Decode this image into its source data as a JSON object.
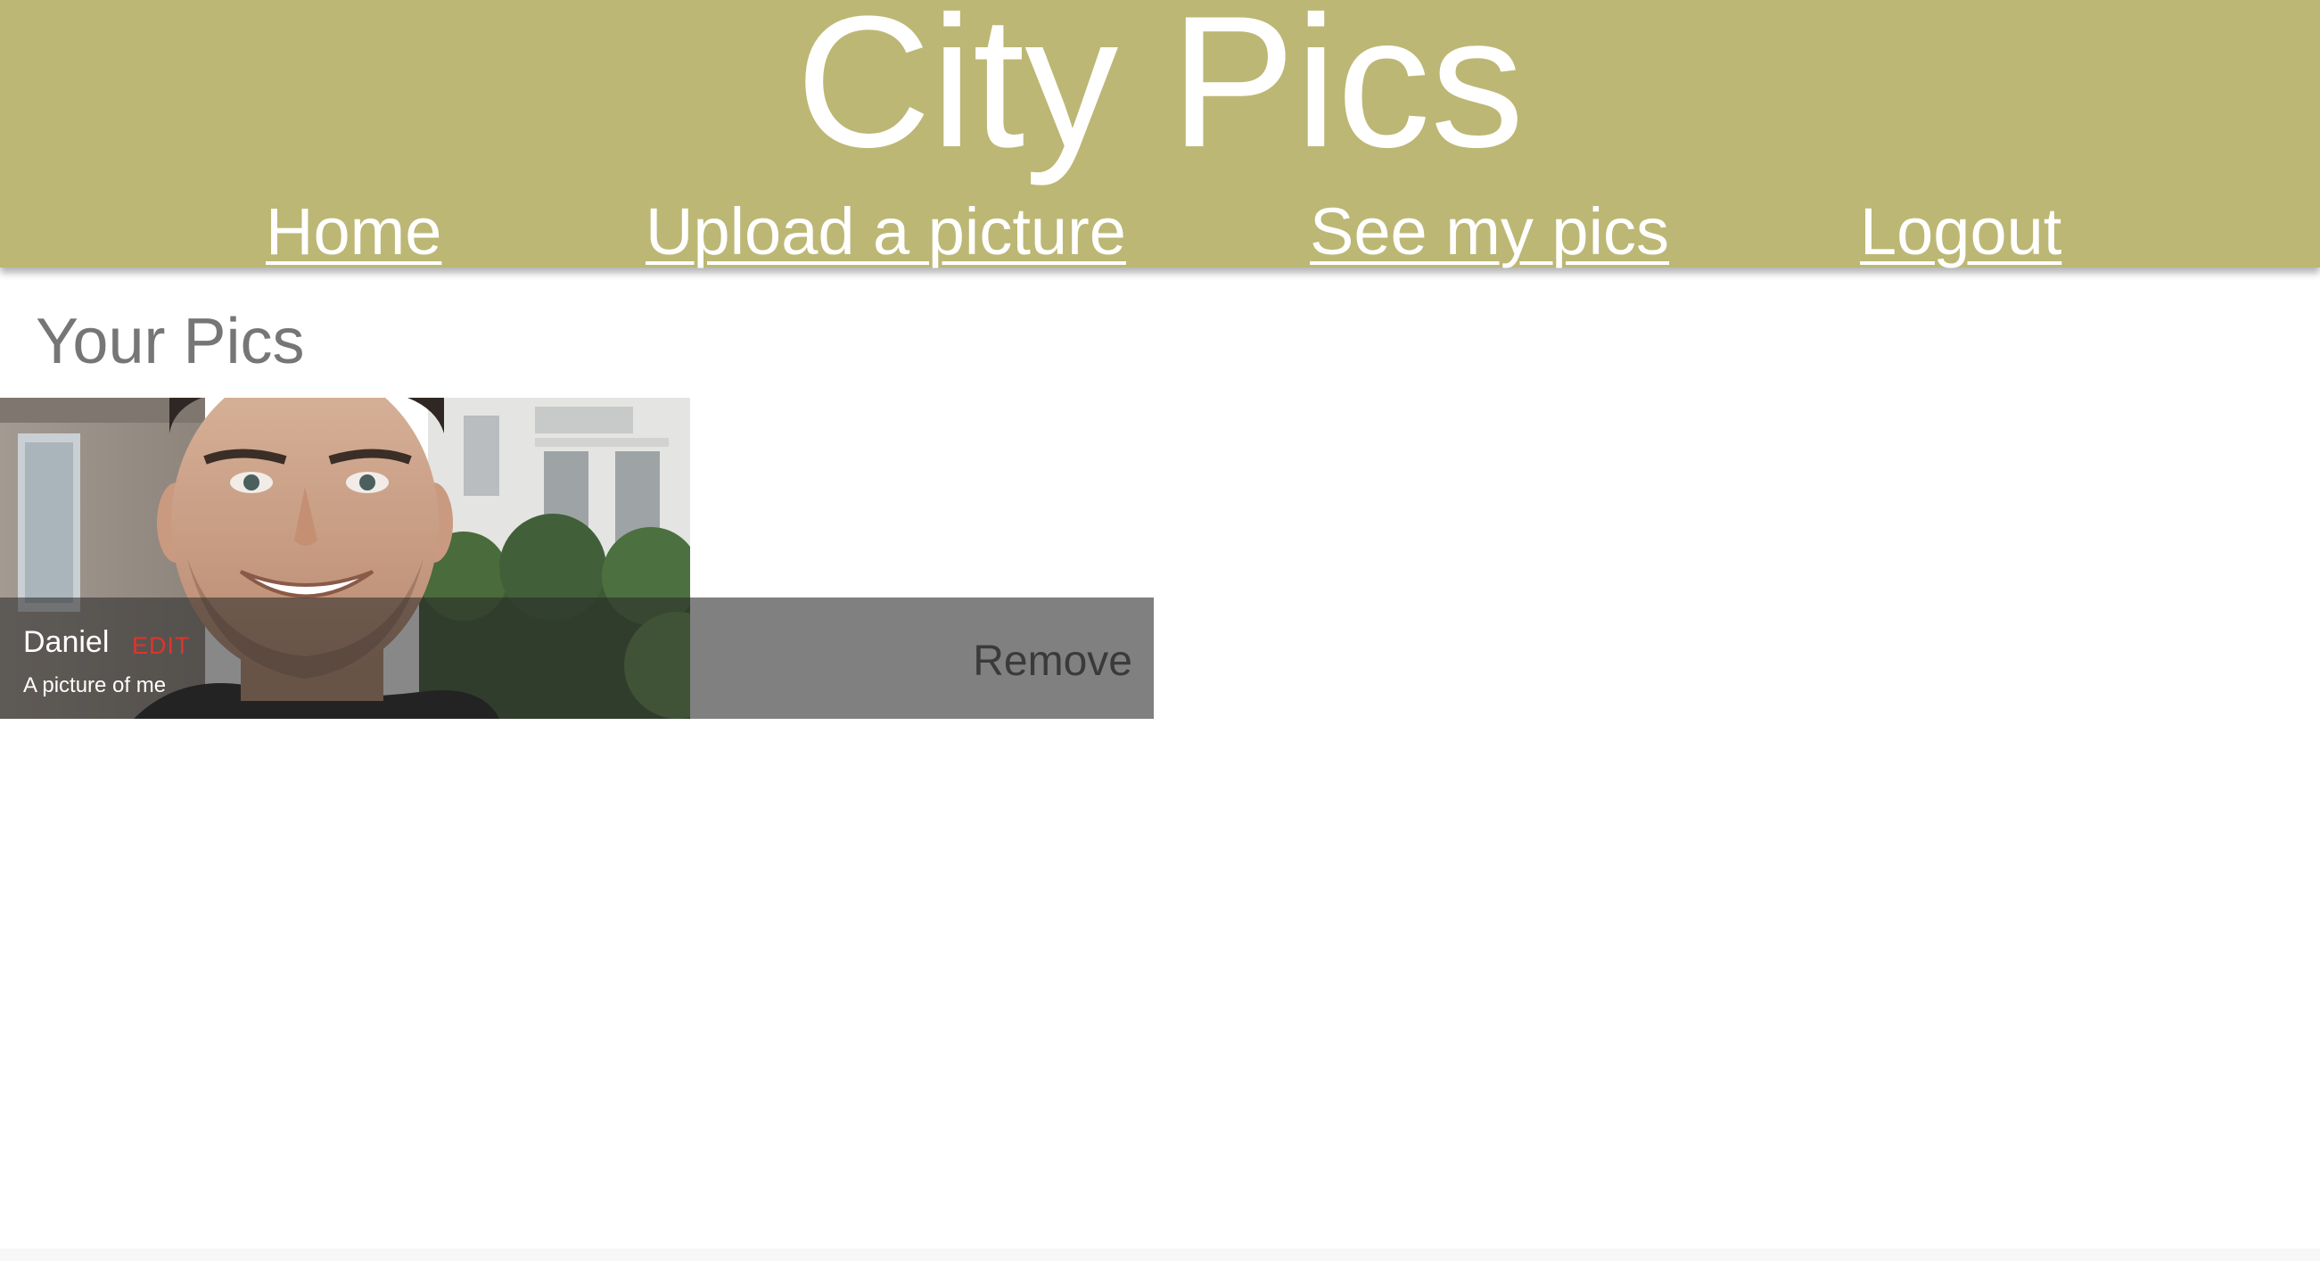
{
  "site": {
    "title": "City Pics",
    "brand_color": "#bcb774"
  },
  "nav": {
    "home": "Home",
    "upload": "Upload a picture",
    "my_pics": "See my pics",
    "logout": "Logout"
  },
  "main": {
    "section_title": "Your Pics",
    "pics": [
      {
        "name": "Daniel",
        "edit_label": "EDIT",
        "description": "A picture of me",
        "remove_label": "Remove",
        "image_icon": "portrait-photo"
      }
    ]
  }
}
